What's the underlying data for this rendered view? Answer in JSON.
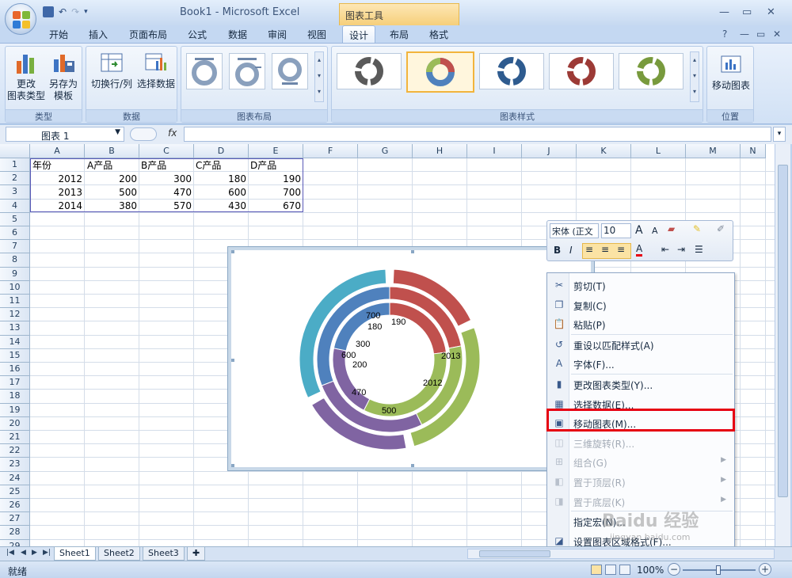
{
  "window": {
    "title": "Book1 - Microsoft Excel",
    "contextual_tab_title": "图表工具",
    "qat_undo": "↶",
    "qat_redo": "↷"
  },
  "ribbon": {
    "tabs": [
      "开始",
      "插入",
      "页面布局",
      "公式",
      "数据",
      "审阅",
      "视图",
      "设计",
      "布局",
      "格式"
    ],
    "active_tab": "设计",
    "groups": {
      "type": {
        "label": "类型",
        "change_chart_type": "更改\n图表类型",
        "save_template": "另存为\n模板"
      },
      "data": {
        "label": "数据",
        "switch_row_col": "切换行/列",
        "select_data": "选择数据"
      },
      "layout": {
        "label": "图表布局"
      },
      "styles": {
        "label": "图表样式"
      },
      "location": {
        "label": "位置",
        "move_chart": "移动图表"
      }
    }
  },
  "formula_bar": {
    "name_box": "图表 1",
    "fx": "fx",
    "value": ""
  },
  "sheet": {
    "columns": [
      "A",
      "B",
      "C",
      "D",
      "E",
      "F",
      "G",
      "H",
      "I",
      "J",
      "K",
      "L",
      "M",
      "N"
    ],
    "rows": [
      "1",
      "2",
      "3",
      "4",
      "5",
      "6",
      "7",
      "8",
      "9",
      "10",
      "11",
      "12",
      "13",
      "14",
      "15",
      "16",
      "17",
      "18",
      "19",
      "20",
      "21",
      "22",
      "23",
      "24",
      "25",
      "26",
      "27",
      "28",
      "29"
    ],
    "cells": {
      "header": [
        "年份",
        "A产品",
        "B产品",
        "C产品",
        "D产品"
      ],
      "r2": [
        "2012",
        "200",
        "300",
        "180",
        "190"
      ],
      "r3": [
        "2013",
        "500",
        "470",
        "600",
        "700"
      ],
      "r4": [
        "2014",
        "380",
        "570",
        "430",
        "670"
      ]
    },
    "tabs": [
      "Sheet1",
      "Sheet2",
      "Sheet3"
    ],
    "active_tab": "Sheet1"
  },
  "chart_data": {
    "type": "doughnut",
    "categories": [
      "A产品",
      "B产品",
      "C产品",
      "D产品"
    ],
    "series": [
      {
        "name": "2012",
        "values": [
          200,
          300,
          180,
          190
        ]
      },
      {
        "name": "2013",
        "values": [
          500,
          470,
          600,
          700
        ]
      },
      {
        "name": "2014",
        "values": [
          380,
          570,
          430,
          670
        ]
      }
    ],
    "colors": [
      "#c0504d",
      "#9bbb59",
      "#8064a2",
      "#4bacc6"
    ],
    "highlight_color": "#4f81bd",
    "shown_labels": [
      "700",
      "180",
      "190",
      "300",
      "600",
      "200",
      "470",
      "500",
      "2013",
      "2012"
    ]
  },
  "mini_toolbar": {
    "font": "宋体 (正文",
    "size": "10",
    "grow": "A",
    "shrink": "A",
    "bold": "B",
    "italic": "I",
    "font_color": "A"
  },
  "context_menu": {
    "items": [
      {
        "label": "剪切(T)",
        "icon": "scissors-icon",
        "glyph": "✂",
        "disabled": false
      },
      {
        "label": "复制(C)",
        "icon": "copy-icon",
        "glyph": "❐",
        "disabled": false
      },
      {
        "label": "粘贴(P)",
        "icon": "paste-icon",
        "glyph": "📋",
        "disabled": false
      },
      {
        "label": "重设以匹配样式(A)",
        "icon": "reset-style-icon",
        "glyph": "↺",
        "disabled": false
      },
      {
        "label": "字体(F)...",
        "icon": "font-icon",
        "glyph": "A",
        "disabled": false
      },
      {
        "label": "更改图表类型(Y)...",
        "icon": "chart-type-icon",
        "glyph": "▮",
        "disabled": false
      },
      {
        "label": "选择数据(E)...",
        "icon": "select-data-icon",
        "glyph": "▦",
        "disabled": false
      },
      {
        "label": "移动图表(M)...",
        "icon": "move-chart-icon",
        "glyph": "▣",
        "disabled": false
      },
      {
        "label": "三维旋转(R)...",
        "icon": "rotate-3d-icon",
        "glyph": "◫",
        "disabled": true
      },
      {
        "label": "组合(G)",
        "icon": "group-icon",
        "glyph": "⊞",
        "disabled": true,
        "submenu": true
      },
      {
        "label": "置于顶层(R)",
        "icon": "bring-front-icon",
        "glyph": "◧",
        "disabled": true,
        "submenu": true
      },
      {
        "label": "置于底层(K)",
        "icon": "send-back-icon",
        "glyph": "◨",
        "disabled": true,
        "submenu": true
      },
      {
        "label": "指定宏(N)...",
        "icon": "macro-icon",
        "glyph": " ",
        "disabled": false
      },
      {
        "label": "设置图表区域格式(F)...",
        "icon": "format-area-icon",
        "glyph": "◪",
        "disabled": false
      }
    ]
  },
  "statusbar": {
    "status": "就绪",
    "zoom": "100%"
  },
  "watermark": {
    "brand": "Baidu 经验",
    "url": "jingyan.baidu.com"
  }
}
